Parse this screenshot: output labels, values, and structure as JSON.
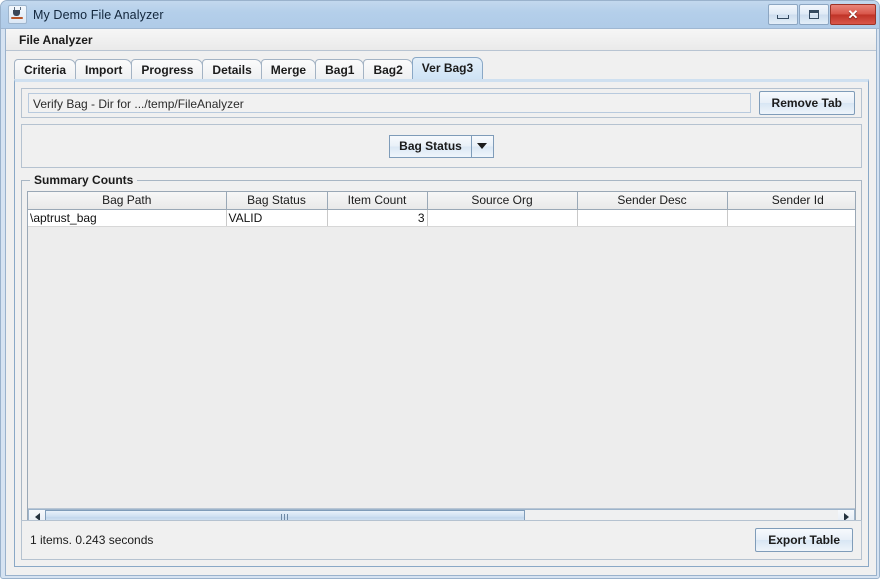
{
  "window": {
    "title": "My Demo File Analyzer",
    "app_icon": "java-cup-icon",
    "buttons": {
      "minimize": "minimize-icon",
      "maximize": "maximize-icon",
      "close": "✕"
    }
  },
  "menubar": {
    "items": [
      {
        "label": "File Analyzer"
      }
    ]
  },
  "tabs": [
    {
      "label": "Criteria",
      "selected": false
    },
    {
      "label": "Import",
      "selected": false
    },
    {
      "label": "Progress",
      "selected": false
    },
    {
      "label": "Details",
      "selected": false
    },
    {
      "label": "Merge",
      "selected": false
    },
    {
      "label": "Bag1",
      "selected": false
    },
    {
      "label": "Bag2",
      "selected": false
    },
    {
      "label": "Ver Bag3",
      "selected": true
    }
  ],
  "toolbar": {
    "path_value": "Verify Bag - Dir for .../temp/FileAnalyzer",
    "path_placeholder": "",
    "remove_tab_label": "Remove Tab"
  },
  "filter": {
    "combo_label": "Bag Status",
    "arrow_icon": "chevron-down-icon"
  },
  "summary": {
    "group_title": "Summary Counts",
    "columns": [
      "Bag Path",
      "Bag Status",
      "Item Count",
      "Source Org",
      "Sender Desc",
      "Sender Id"
    ],
    "rows": [
      {
        "bag_path": "\\aptrust_bag",
        "bag_status": "VALID",
        "item_count": "3",
        "source_org": "",
        "sender_desc": "",
        "sender_id": ""
      }
    ]
  },
  "scrollbar": {
    "left_icon": "arrow-left-icon",
    "right_icon": "arrow-right-icon",
    "grip_icon": "grip-icon"
  },
  "statusbar": {
    "text": "1 items.  0.243 seconds",
    "export_label": "Export Table"
  },
  "colors": {
    "titlebar": "#b4cfea",
    "close_button": "#bf3327",
    "selected_tab": "#cfe3f5",
    "panel_background": "#f0f0f0",
    "table_row_background": "#ffffff"
  }
}
